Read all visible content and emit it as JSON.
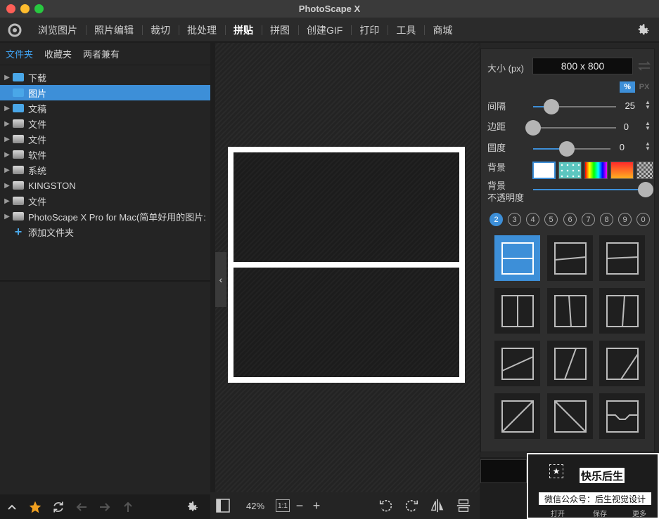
{
  "window": {
    "title": "PhotoScape X"
  },
  "menu": {
    "items": [
      "浏览图片",
      "照片编辑",
      "裁切",
      "批处理",
      "拼贴",
      "拼图",
      "创建GIF",
      "打印",
      "工具",
      "商城"
    ],
    "active": "拼贴"
  },
  "left_panel": {
    "tabs": [
      "文件夹",
      "收藏夹",
      "两者兼有"
    ],
    "active_tab": "文件夹",
    "tree": [
      {
        "label": "下载",
        "icon": "folder-icon",
        "selected": false
      },
      {
        "label": "图片",
        "icon": "folder-icon",
        "selected": true
      },
      {
        "label": "文稿",
        "icon": "folder-icon",
        "selected": false
      },
      {
        "label": "文件",
        "icon": "drive-icon",
        "selected": false
      },
      {
        "label": "文件",
        "icon": "drive-icon",
        "selected": false
      },
      {
        "label": "软件",
        "icon": "drive-icon",
        "selected": false
      },
      {
        "label": "系统",
        "icon": "drive-icon",
        "selected": false
      },
      {
        "label": "KINGSTON",
        "icon": "drive-icon",
        "selected": false
      },
      {
        "label": "文件",
        "icon": "drive-icon",
        "selected": false
      },
      {
        "label": "PhotoScape X Pro for Mac(简单好用的图片:",
        "icon": "drive-icon",
        "selected": false
      }
    ],
    "add_folder": "添加文件夹"
  },
  "canvas_toolbar": {
    "zoom": "42%",
    "one_to_one": "1:1",
    "minus": "−",
    "plus": "+"
  },
  "settings": {
    "size_label": "大小 (px)",
    "size_value": "800 x 800",
    "unit_percent": "%",
    "unit_px": "PX",
    "spacing": {
      "label": "间隔",
      "value": "25",
      "fraction": 0.22
    },
    "margin": {
      "label": "边距",
      "value": "0",
      "fraction": 0.0
    },
    "roundness": {
      "label": "圆度",
      "value": "0",
      "fraction": 0.44
    },
    "background_label": "背景",
    "opacity_label_1": "背景",
    "opacity_label_2": "不透明度",
    "opacity_fraction": 1.0,
    "count_options": [
      "2",
      "3",
      "4",
      "5",
      "6",
      "7",
      "8",
      "9",
      "0"
    ],
    "active_count": "2"
  },
  "bottom_actions": {
    "open": "打开",
    "save": "保存",
    "more": "更多"
  },
  "watermark": {
    "line1": "快乐后生",
    "line2": "微信公众号：后生视觉设计"
  },
  "colors": {
    "accent": "#3d8fd8",
    "background": "#1e1e1e"
  }
}
